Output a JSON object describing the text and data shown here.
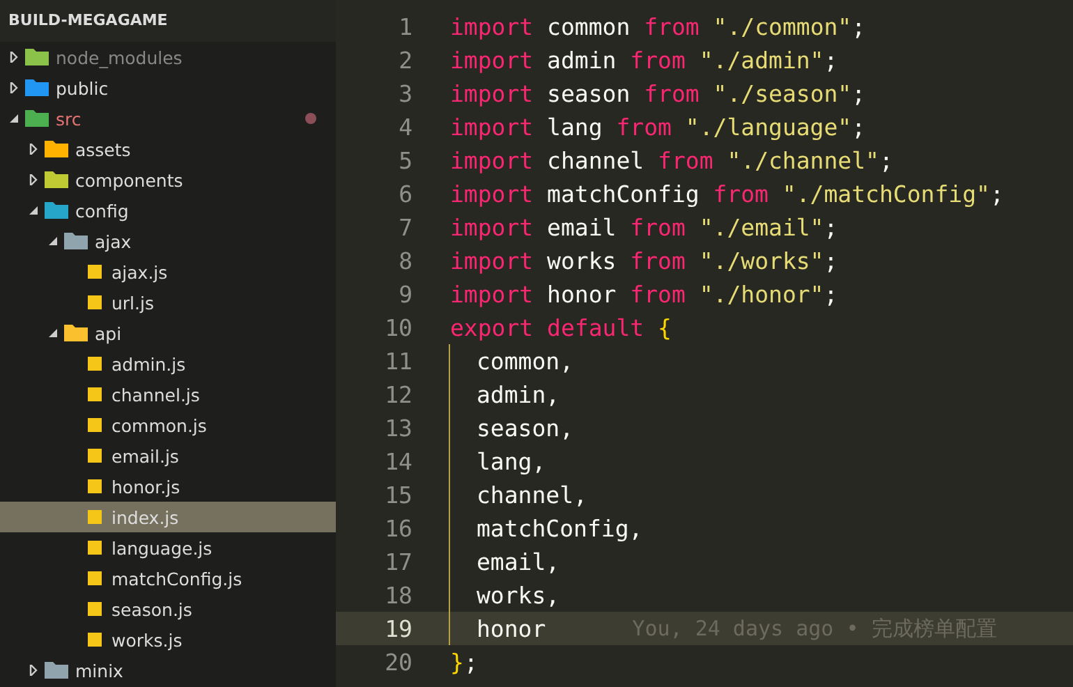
{
  "explorer": {
    "title": "BUILD-MEGAGAME",
    "tree": [
      {
        "label": "node_modules",
        "kind": "folder",
        "color": "#8bc34a",
        "expanded": false,
        "selected": false,
        "dimmed": true,
        "modified": false
      },
      {
        "label": "public",
        "kind": "folder",
        "color": "#2196f3",
        "expanded": false,
        "selected": false,
        "dimmed": false,
        "modified": false
      },
      {
        "label": "src",
        "kind": "folder",
        "color": "#4caf50",
        "expanded": true,
        "selected": false,
        "dimmed": false,
        "modified": true,
        "children": [
          {
            "label": "assets",
            "kind": "folder",
            "color": "#ffb300",
            "expanded": false,
            "selected": false
          },
          {
            "label": "components",
            "kind": "folder",
            "color": "#c0ca33",
            "expanded": false,
            "selected": false
          },
          {
            "label": "config",
            "kind": "folder",
            "color": "#26a6c9",
            "expanded": true,
            "selected": false,
            "children": [
              {
                "label": "ajax",
                "kind": "folder",
                "color": "#90a4ae",
                "expanded": true,
                "selected": false,
                "children": [
                  {
                    "label": "ajax.js",
                    "kind": "file",
                    "selected": false
                  },
                  {
                    "label": "url.js",
                    "kind": "file",
                    "selected": false
                  }
                ]
              },
              {
                "label": "api",
                "kind": "folder",
                "color": "#fbc02d",
                "expanded": true,
                "selected": false,
                "children": [
                  {
                    "label": "admin.js",
                    "kind": "file",
                    "selected": false
                  },
                  {
                    "label": "channel.js",
                    "kind": "file",
                    "selected": false
                  },
                  {
                    "label": "common.js",
                    "kind": "file",
                    "selected": false
                  },
                  {
                    "label": "email.js",
                    "kind": "file",
                    "selected": false
                  },
                  {
                    "label": "honor.js",
                    "kind": "file",
                    "selected": false
                  },
                  {
                    "label": "index.js",
                    "kind": "file",
                    "selected": true
                  },
                  {
                    "label": "language.js",
                    "kind": "file",
                    "selected": false
                  },
                  {
                    "label": "matchConfig.js",
                    "kind": "file",
                    "selected": false
                  },
                  {
                    "label": "season.js",
                    "kind": "file",
                    "selected": false
                  },
                  {
                    "label": "works.js",
                    "kind": "file",
                    "selected": false
                  }
                ]
              }
            ]
          },
          {
            "label": "minix",
            "kind": "folder",
            "color": "#90a4ae",
            "expanded": false,
            "selected": false
          }
        ]
      }
    ]
  },
  "editor": {
    "lines": [
      {
        "number": "1",
        "current": false,
        "indented": false,
        "tokens": [
          {
            "kind": "keyword",
            "text": "import"
          },
          {
            "kind": "ident",
            "text": " common "
          },
          {
            "kind": "keyword",
            "text": "from"
          },
          {
            "kind": "string",
            "text": " \"./common\""
          },
          {
            "kind": "ident",
            "text": ";"
          }
        ]
      },
      {
        "number": "2",
        "current": false,
        "indented": false,
        "tokens": [
          {
            "kind": "keyword",
            "text": "import"
          },
          {
            "kind": "ident",
            "text": " admin "
          },
          {
            "kind": "keyword",
            "text": "from"
          },
          {
            "kind": "string",
            "text": " \"./admin\""
          },
          {
            "kind": "ident",
            "text": ";"
          }
        ]
      },
      {
        "number": "3",
        "current": false,
        "indented": false,
        "tokens": [
          {
            "kind": "keyword",
            "text": "import"
          },
          {
            "kind": "ident",
            "text": " season "
          },
          {
            "kind": "keyword",
            "text": "from"
          },
          {
            "kind": "string",
            "text": " \"./season\""
          },
          {
            "kind": "ident",
            "text": ";"
          }
        ]
      },
      {
        "number": "4",
        "current": false,
        "indented": false,
        "tokens": [
          {
            "kind": "keyword",
            "text": "import"
          },
          {
            "kind": "ident",
            "text": " lang "
          },
          {
            "kind": "keyword",
            "text": "from"
          },
          {
            "kind": "string",
            "text": " \"./language\""
          },
          {
            "kind": "ident",
            "text": ";"
          }
        ]
      },
      {
        "number": "5",
        "current": false,
        "indented": false,
        "tokens": [
          {
            "kind": "keyword",
            "text": "import"
          },
          {
            "kind": "ident",
            "text": " channel "
          },
          {
            "kind": "keyword",
            "text": "from"
          },
          {
            "kind": "string",
            "text": " \"./channel\""
          },
          {
            "kind": "ident",
            "text": ";"
          }
        ]
      },
      {
        "number": "6",
        "current": false,
        "indented": false,
        "tokens": [
          {
            "kind": "keyword",
            "text": "import"
          },
          {
            "kind": "ident",
            "text": " matchConfig "
          },
          {
            "kind": "keyword",
            "text": "from"
          },
          {
            "kind": "string",
            "text": " \"./matchConfig\""
          },
          {
            "kind": "ident",
            "text": ";"
          }
        ]
      },
      {
        "number": "7",
        "current": false,
        "indented": false,
        "tokens": [
          {
            "kind": "keyword",
            "text": "import"
          },
          {
            "kind": "ident",
            "text": " email "
          },
          {
            "kind": "keyword",
            "text": "from"
          },
          {
            "kind": "string",
            "text": " \"./email\""
          },
          {
            "kind": "ident",
            "text": ";"
          }
        ]
      },
      {
        "number": "8",
        "current": false,
        "indented": false,
        "tokens": [
          {
            "kind": "keyword",
            "text": "import"
          },
          {
            "kind": "ident",
            "text": " works "
          },
          {
            "kind": "keyword",
            "text": "from"
          },
          {
            "kind": "string",
            "text": " \"./works\""
          },
          {
            "kind": "ident",
            "text": ";"
          }
        ]
      },
      {
        "number": "9",
        "current": false,
        "indented": false,
        "tokens": [
          {
            "kind": "keyword",
            "text": "import"
          },
          {
            "kind": "ident",
            "text": " honor "
          },
          {
            "kind": "keyword",
            "text": "from"
          },
          {
            "kind": "string",
            "text": " \"./honor\""
          },
          {
            "kind": "ident",
            "text": ";"
          }
        ]
      },
      {
        "number": "10",
        "current": false,
        "indented": false,
        "tokens": [
          {
            "kind": "keyword",
            "text": "export"
          },
          {
            "kind": "keyword",
            "text": " default"
          },
          {
            "kind": "brace",
            "text": " {"
          }
        ]
      },
      {
        "number": "11",
        "current": false,
        "indented": true,
        "tokens": [
          {
            "kind": "ident",
            "text": "common,"
          }
        ]
      },
      {
        "number": "12",
        "current": false,
        "indented": true,
        "tokens": [
          {
            "kind": "ident",
            "text": "admin,"
          }
        ]
      },
      {
        "number": "13",
        "current": false,
        "indented": true,
        "tokens": [
          {
            "kind": "ident",
            "text": "season,"
          }
        ]
      },
      {
        "number": "14",
        "current": false,
        "indented": true,
        "tokens": [
          {
            "kind": "ident",
            "text": "lang,"
          }
        ]
      },
      {
        "number": "15",
        "current": false,
        "indented": true,
        "tokens": [
          {
            "kind": "ident",
            "text": "channel,"
          }
        ]
      },
      {
        "number": "16",
        "current": false,
        "indented": true,
        "tokens": [
          {
            "kind": "ident",
            "text": "matchConfig,"
          }
        ]
      },
      {
        "number": "17",
        "current": false,
        "indented": true,
        "tokens": [
          {
            "kind": "ident",
            "text": "email,"
          }
        ]
      },
      {
        "number": "18",
        "current": false,
        "indented": true,
        "tokens": [
          {
            "kind": "ident",
            "text": "works,"
          }
        ]
      },
      {
        "number": "19",
        "current": true,
        "indented": true,
        "tokens": [
          {
            "kind": "ident",
            "text": "honor"
          }
        ],
        "blame": "You, 24 days ago • 完成榜单配置"
      },
      {
        "number": "20",
        "current": false,
        "indented": false,
        "tokens": [
          {
            "kind": "brace",
            "text": "}"
          },
          {
            "kind": "ident",
            "text": ";"
          }
        ]
      }
    ]
  }
}
